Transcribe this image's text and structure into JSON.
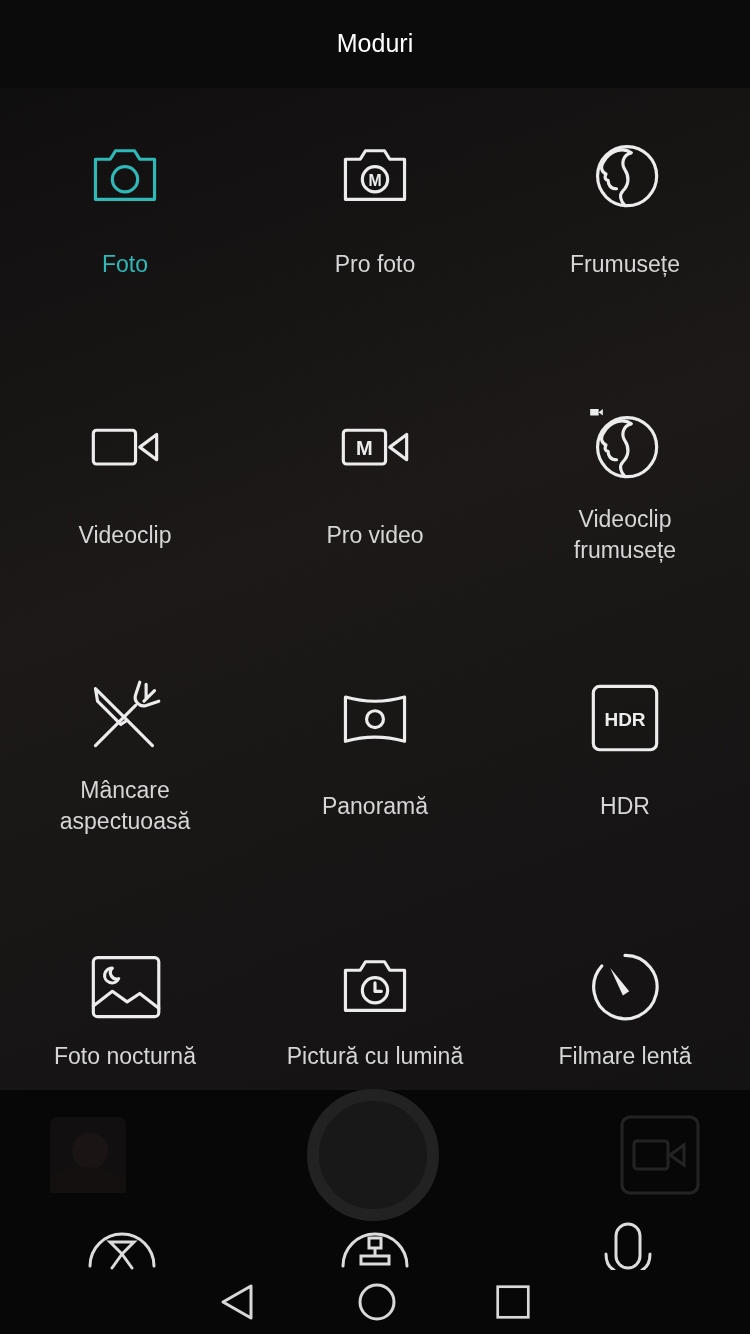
{
  "title": "Moduri",
  "modes": [
    {
      "label": "Foto",
      "kind": "camera",
      "selected": true
    },
    {
      "label": "Pro foto",
      "kind": "camerapro",
      "badge": "M",
      "selected": false
    },
    {
      "label": "Frumusețe",
      "kind": "beauty",
      "selected": false
    },
    {
      "label": "Videoclip",
      "kind": "video",
      "selected": false
    },
    {
      "label": "Pro video",
      "kind": "videopro",
      "badge": "M",
      "selected": false
    },
    {
      "label": "Videoclip frumusețe",
      "kind": "beautyvideo",
      "selected": false
    },
    {
      "label": "Mâncare aspectuoasă",
      "kind": "food",
      "selected": false
    },
    {
      "label": "Panoramă",
      "kind": "panorama",
      "selected": false
    },
    {
      "label": "HDR",
      "kind": "hdr",
      "badge": "HDR",
      "selected": false
    },
    {
      "label": "Foto nocturnă",
      "kind": "night",
      "selected": false
    },
    {
      "label": "Pictură cu lumină",
      "kind": "lightpainting",
      "selected": false
    },
    {
      "label": "Filmare lentă",
      "kind": "slowmotion",
      "selected": false
    }
  ]
}
